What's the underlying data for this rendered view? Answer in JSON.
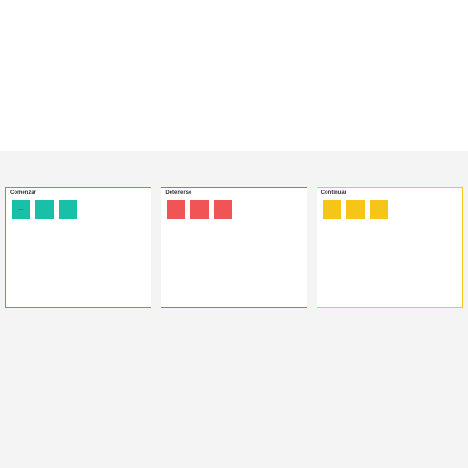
{
  "columns": [
    {
      "key": "start",
      "title": "Comenzar",
      "notes": [
        {
          "label": "idea"
        },
        {
          "label": ""
        },
        {
          "label": ""
        }
      ]
    },
    {
      "key": "stop",
      "title": "Detenerse",
      "notes": [
        {
          "label": ""
        },
        {
          "label": ""
        },
        {
          "label": ""
        }
      ]
    },
    {
      "key": "continue",
      "title": "Continuar",
      "notes": [
        {
          "label": ""
        },
        {
          "label": ""
        },
        {
          "label": ""
        }
      ]
    }
  ]
}
